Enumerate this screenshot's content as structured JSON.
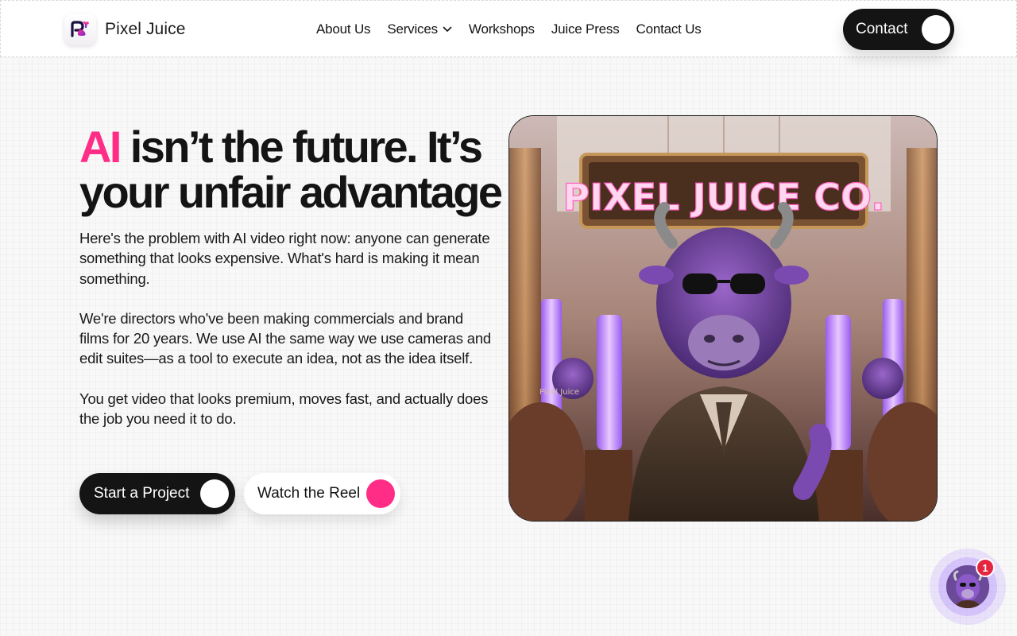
{
  "brand": {
    "name": "Pixel Juice",
    "logo_icon": "pixel-juice-logo-icon",
    "accent_color": "#ff2d86"
  },
  "nav": {
    "items": [
      {
        "label": "About Us"
      },
      {
        "label": "Services",
        "has_dropdown": true,
        "icon": "chevron-down-icon"
      },
      {
        "label": "Workshops"
      },
      {
        "label": "Juice Press"
      },
      {
        "label": "Contact Us"
      }
    ],
    "contact_button": "Contact"
  },
  "hero": {
    "headline_accent": "AI",
    "headline_rest": " isn’t the future. It’s your unfair advantage",
    "paragraphs": [
      "Here's the problem with AI video right now: anyone can generate something that looks expensive. What's hard is making it mean something.",
      "We're directors who've been making commercials and brand films for 20 years. We use AI the same way we use cameras and edit suites—as a tool to execute an idea, not as the idea itself.",
      "You get video that looks premium, moves fast, and actually does the job you need it to do."
    ],
    "primary_cta": "Start a Project",
    "secondary_cta": "Watch the Reel",
    "image": {
      "sign_text": "PIXEL JUICE CO.",
      "patch_text": "Pixel Juice"
    }
  },
  "chat_widget": {
    "badge_count": "1",
    "avatar_icon": "purple-bull-avatar-icon"
  }
}
